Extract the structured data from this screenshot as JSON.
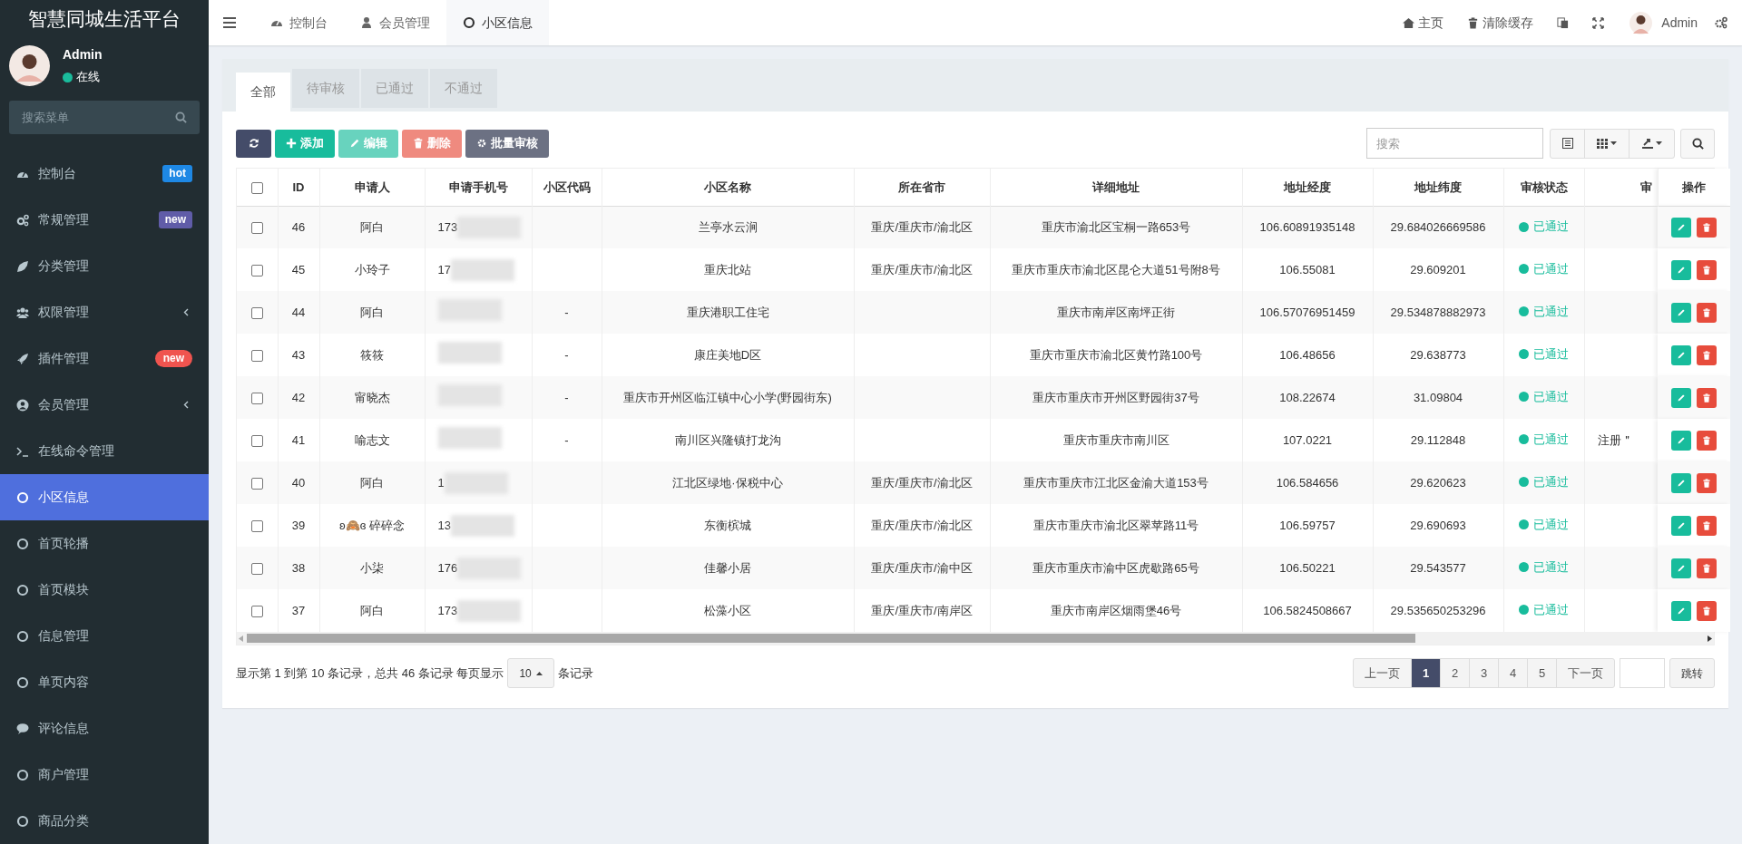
{
  "sidebar": {
    "logo": "智慧同城生活平台",
    "user": {
      "name": "Admin",
      "status": "在线"
    },
    "search": {
      "placeholder": "搜索菜单"
    },
    "items": [
      {
        "label": "控制台",
        "kind": "dashboard",
        "badge": {
          "text": "hot",
          "color": "#1e88e5",
          "kind": "square"
        },
        "selected": false
      },
      {
        "label": "常规管理",
        "kind": "cogs",
        "badge": {
          "text": "new",
          "color": "#605ca8",
          "kind": "square"
        },
        "selected": false
      },
      {
        "label": "分类管理",
        "kind": "leaf",
        "selected": false
      },
      {
        "label": "权限管理",
        "kind": "users",
        "expandable": true,
        "selected": false
      },
      {
        "label": "插件管理",
        "kind": "rocket",
        "badge": {
          "text": "new",
          "color": "#f0544f",
          "kind": "pill"
        },
        "selected": false
      },
      {
        "label": "会员管理",
        "kind": "user-circle",
        "expandable": true,
        "selected": false
      },
      {
        "label": "在线命令管理",
        "kind": "terminal",
        "selected": false
      },
      {
        "label": "小区信息",
        "kind": "circle",
        "selected": true
      },
      {
        "label": "首页轮播",
        "kind": "circle",
        "selected": false
      },
      {
        "label": "首页模块",
        "kind": "circle",
        "selected": false
      },
      {
        "label": "信息管理",
        "kind": "circle",
        "selected": false
      },
      {
        "label": "单页内容",
        "kind": "circle",
        "selected": false
      },
      {
        "label": "评论信息",
        "kind": "comment",
        "selected": false
      },
      {
        "label": "商户管理",
        "kind": "circle",
        "selected": false
      },
      {
        "label": "商品分类",
        "kind": "circle",
        "selected": false
      }
    ]
  },
  "topbar": {
    "tabs": [
      {
        "label": "控制台",
        "kind": "dashboard",
        "selected": false
      },
      {
        "label": "会员管理",
        "kind": "user",
        "selected": false
      },
      {
        "label": "小区信息",
        "kind": "circle",
        "selected": true
      }
    ],
    "actions": [
      {
        "label": "主页",
        "kind": "home"
      },
      {
        "label": "清除缓存",
        "kind": "trash"
      },
      {
        "kind": "translate"
      },
      {
        "kind": "fullscreen"
      }
    ],
    "user": "Admin"
  },
  "filter_tabs": [
    {
      "label": "全部",
      "selected": true
    },
    {
      "label": "待审核",
      "selected": false
    },
    {
      "label": "已通过",
      "selected": false
    },
    {
      "label": "不通过",
      "selected": false
    }
  ],
  "toolbar": {
    "buttons": [
      {
        "kind": "refresh",
        "disabled": false
      },
      {
        "kind": "add",
        "label": "添加",
        "disabled": false
      },
      {
        "kind": "edit",
        "label": "编辑",
        "disabled": true
      },
      {
        "kind": "delete",
        "label": "删除",
        "disabled": true
      },
      {
        "kind": "audit",
        "label": "批量审核",
        "disabled": false
      }
    ],
    "search": {
      "placeholder": "搜索"
    }
  },
  "table": {
    "header_checked": false,
    "columns": [
      "ID",
      "申请人",
      "申请手机号",
      "小区代码",
      "小区名称",
      "所在省市",
      "详细地址",
      "地址经度",
      "地址纬度",
      "审核状态",
      "审",
      "操作"
    ],
    "rows": [
      {
        "checked": false,
        "id": "46",
        "applicant": "阿白",
        "phone": "173",
        "name": "兰亭水云涧",
        "region": "重庆/重庆市/渝北区",
        "address": "重庆市渝北区宝桐一路653号",
        "lng": "106.60891935148",
        "lat": "29.684026669586",
        "status": "已通过"
      },
      {
        "checked": false,
        "id": "45",
        "applicant": "小玲子",
        "phone": "17",
        "name": "重庆北站",
        "region": "重庆/重庆市/渝北区",
        "address": "重庆市重庆市渝北区昆仑大道51号附8号",
        "lng": "106.55081",
        "lat": "29.609201",
        "status": "已通过"
      },
      {
        "checked": false,
        "id": "44",
        "applicant": "阿白",
        "code": "-",
        "name": "重庆港职工住宅",
        "address": "重庆市南岸区南坪正街",
        "lng": "106.57076951459",
        "lat": "29.534878882973",
        "status": "已通过"
      },
      {
        "checked": false,
        "id": "43",
        "applicant": "筱筱",
        "code": "-",
        "name": "康庄美地D区",
        "address": "重庆市重庆市渝北区黄竹路100号",
        "lng": "106.48656",
        "lat": "29.638773",
        "status": "已通过"
      },
      {
        "checked": false,
        "id": "42",
        "applicant": "甯晓杰",
        "code": "-",
        "name": "重庆市开州区临江镇中心小学(野园街东)",
        "address": "重庆市重庆市开州区野园街37号",
        "lng": "108.22674",
        "lat": "31.09804",
        "status": "已通过"
      },
      {
        "checked": false,
        "id": "41",
        "applicant": "喻志文",
        "code": "-",
        "name": "南川区兴隆镇打龙沟",
        "address": "重庆市重庆市南川区",
        "lng": "107.0221",
        "lat": "29.112848",
        "status": "已通过",
        "note": "注册＂"
      },
      {
        "checked": false,
        "id": "40",
        "applicant": "阿白",
        "phone": "1",
        "name": "江北区绿地·保税中心",
        "region": "重庆/重庆市/渝北区",
        "address": "重庆市重庆市江北区金渝大道153号",
        "lng": "106.584656",
        "lat": "29.620623",
        "status": "已通过"
      },
      {
        "checked": false,
        "id": "39",
        "applicant": "ʚ🙈ɞ 碎碎念",
        "phone": "13",
        "name": "东衡槟城",
        "region": "重庆/重庆市/渝北区",
        "address": "重庆市重庆市渝北区翠苹路11号",
        "lng": "106.59757",
        "lat": "29.690693",
        "status": "已通过"
      },
      {
        "checked": false,
        "id": "38",
        "applicant": "小柒",
        "phone": "176",
        "name": "佳馨小居",
        "region": "重庆/重庆市/渝中区",
        "address": "重庆市重庆市渝中区虎歇路65号",
        "lng": "106.50221",
        "lat": "29.543577",
        "status": "已通过"
      },
      {
        "checked": false,
        "id": "37",
        "applicant": "阿白",
        "phone": "173",
        "name": "松藻小区",
        "region": "重庆/重庆市/南岸区",
        "address": "重庆市南岸区烟雨堡46号",
        "lng": "106.5824508667",
        "lat": "29.535650253296",
        "status": "已通过"
      }
    ]
  },
  "pagination": {
    "summary": "显示第 1 到第 10 条记录，总共 46 条记录 每页显示",
    "page_size": "10",
    "suffix": "条记录",
    "prev": "上一页",
    "pages": [
      {
        "label": "1",
        "selected": true
      },
      {
        "label": "2",
        "selected": false
      },
      {
        "label": "3",
        "selected": false
      },
      {
        "label": "4",
        "selected": false
      },
      {
        "label": "5",
        "selected": false
      }
    ],
    "next": "下一页",
    "jump": "跳转"
  }
}
